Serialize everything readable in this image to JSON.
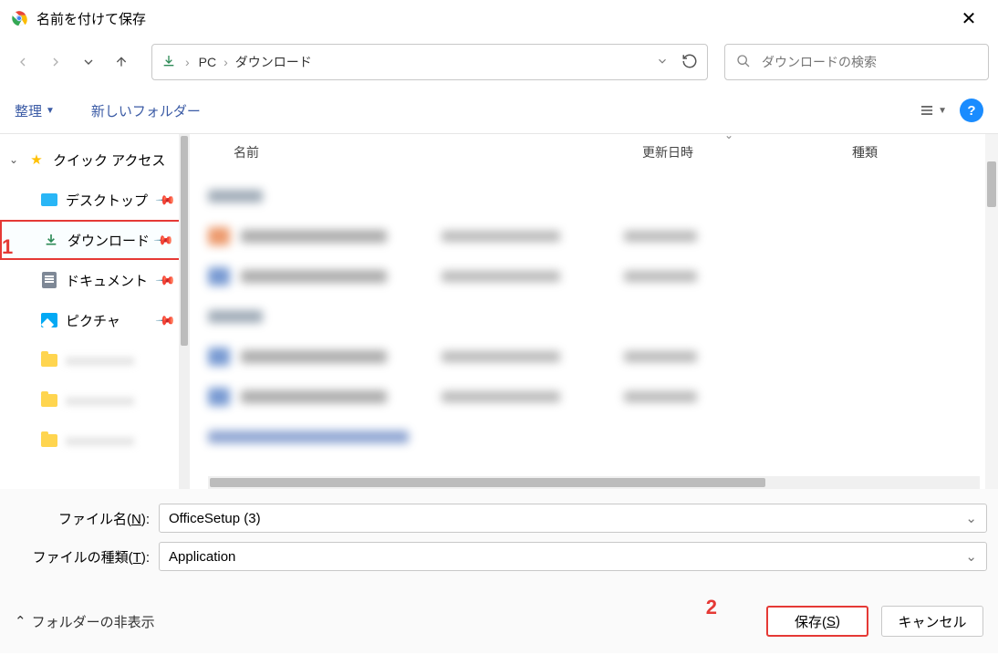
{
  "window": {
    "title": "名前を付けて保存"
  },
  "nav": {
    "breadcrumb": {
      "root": "PC",
      "folder": "ダウンロード"
    },
    "search_placeholder": "ダウンロードの検索"
  },
  "toolbar": {
    "organize": "整理",
    "newfolder": "新しいフォルダー"
  },
  "sidebar": {
    "quick_access": "クイック アクセス",
    "items": [
      {
        "label": "デスクトップ",
        "pinned": true
      },
      {
        "label": "ダウンロード",
        "pinned": true,
        "selected": true
      },
      {
        "label": "ドキュメント",
        "pinned": true
      },
      {
        "label": "ピクチャ",
        "pinned": true
      }
    ]
  },
  "columns": {
    "name": "名前",
    "date": "更新日時",
    "type": "種類"
  },
  "form": {
    "filename_label_pre": "ファイル名(",
    "filename_label_key": "N",
    "filename_label_post": "):",
    "filename_value": "OfficeSetup (3)",
    "filetype_label_pre": "ファイルの種類(",
    "filetype_label_key": "T",
    "filetype_label_post": "):",
    "filetype_value": "Application"
  },
  "footer": {
    "hide_folders": "フォルダーの非表示",
    "save_pre": "保存(",
    "save_key": "S",
    "save_post": ")",
    "cancel": "キャンセル"
  },
  "annotations": {
    "one": "1",
    "two": "2"
  }
}
